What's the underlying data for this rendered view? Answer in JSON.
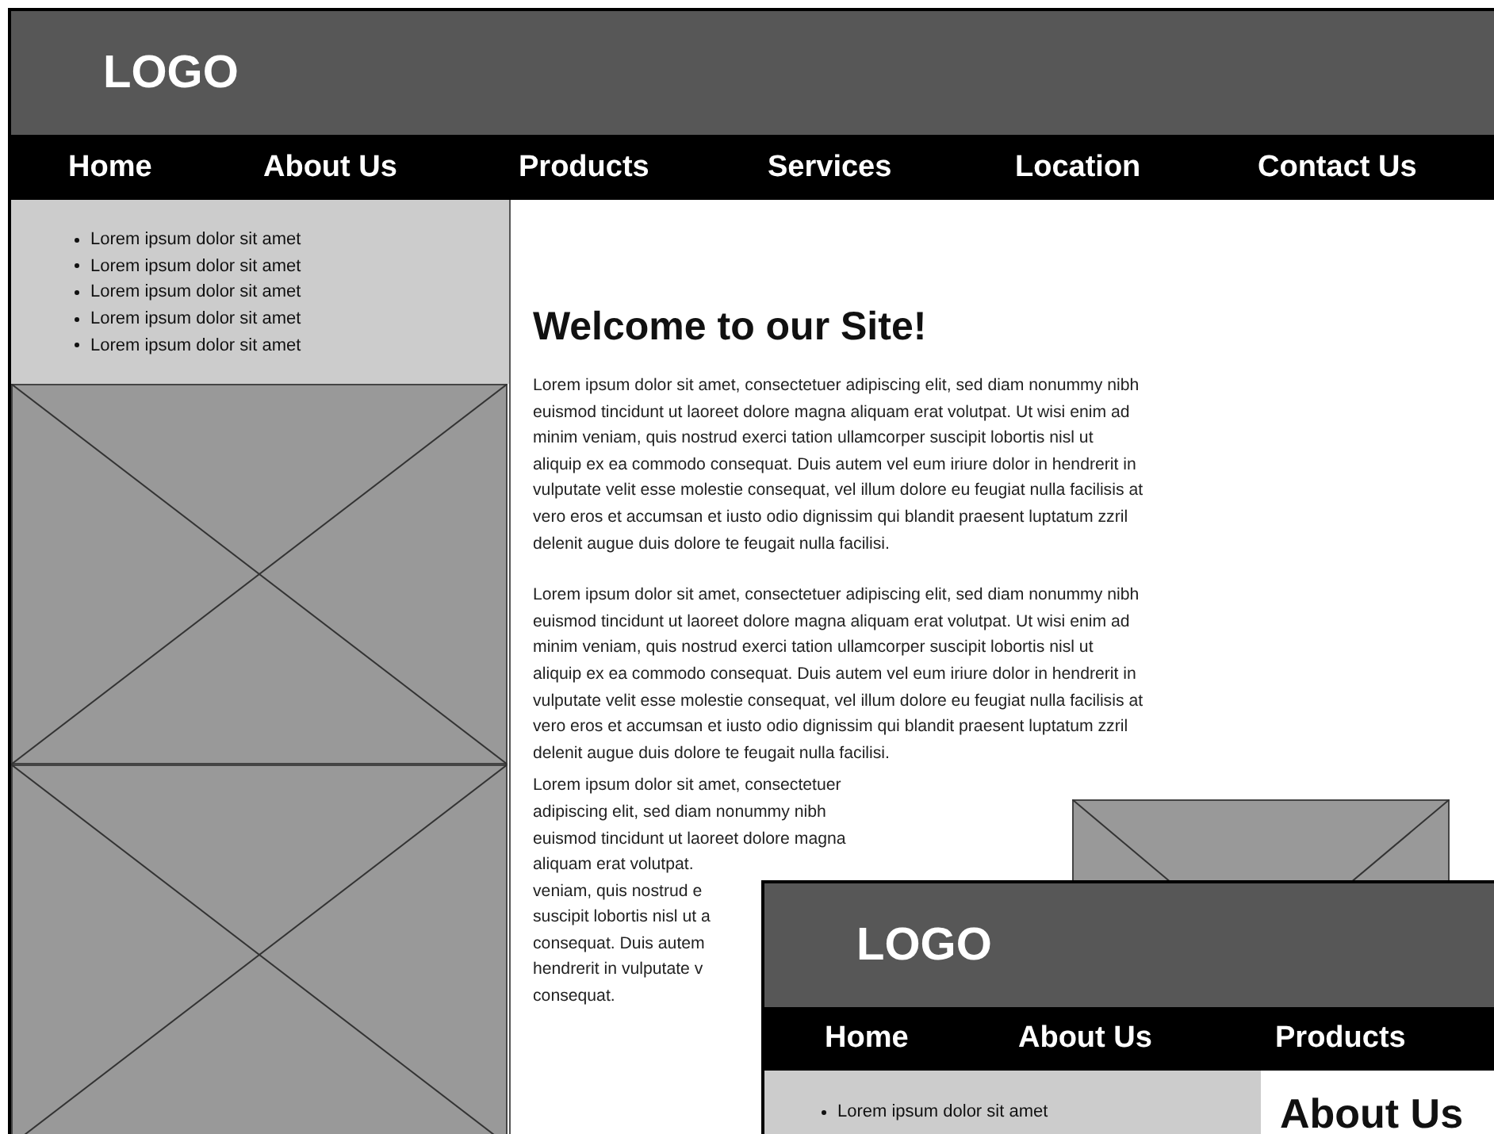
{
  "page": {
    "logo": "LOGO",
    "nav": [
      "Home",
      "About Us",
      "Products",
      "Services",
      "Location",
      "Contact Us"
    ],
    "sidebar_items": [
      "Lorem ipsum dolor sit amet",
      "Lorem ipsum dolor sit amet",
      "Lorem ipsum dolor sit amet",
      "Lorem ipsum dolor sit amet",
      "Lorem ipsum dolor sit amet"
    ],
    "heading": "Welcome to our Site!",
    "paragraphs": [
      {
        "lines": [
          "Lorem ipsum dolor sit amet, consectetuer adipiscing elit, sed diam nonummy nibh",
          "euismod tincidunt ut laoreet dolore magna aliquam erat volutpat. Ut wisi enim ad",
          "minim veniam, quis nostrud exerci tation ullamcorper suscipit lobortis nisl ut",
          "aliquip ex ea commodo consequat. Duis autem vel eum iriure dolor in hendrerit in",
          "vulputate velit esse molestie consequat, vel illum dolore eu feugiat nulla facilisis at",
          "vero eros et accumsan et iusto odio dignissim qui blandit praesent luptatum zzril",
          "delenit augue duis dolore te feugait nulla facilisi."
        ]
      },
      {
        "lines": [
          "Lorem ipsum dolor sit amet, consectetuer adipiscing elit, sed diam nonummy nibh",
          "euismod tincidunt ut laoreet dolore magna aliquam erat volutpat. Ut wisi enim ad",
          "minim veniam, quis nostrud exerci tation ullamcorper suscipit lobortis nisl ut",
          "aliquip ex ea commodo consequat. Duis autem vel eum iriure dolor in hendrerit in",
          "vulputate velit esse molestie consequat, vel illum dolore eu feugiat nulla facilisis at",
          "vero eros et accumsan et iusto odio dignissim qui blandit praesent luptatum zzril",
          "delenit augue duis dolore te feugait nulla facilisi."
        ]
      }
    ],
    "side_paragraph": {
      "lines": [
        "Lorem ipsum dolor sit amet, consectetuer",
        "adipiscing elit, sed diam nonummy nibh",
        "euismod tincidunt ut laoreet dolore magna",
        "aliquam erat volutpat.",
        "veniam, quis nostrud e",
        "suscipit lobortis nisl ut a",
        "consequat. Duis autem",
        "hendrerit in vulputate v",
        "consequat."
      ]
    }
  },
  "overlay_page": {
    "logo": "LOGO",
    "nav": [
      "Home",
      "About Us",
      "Products"
    ],
    "sidebar_items": [
      "Lorem ipsum dolor sit amet"
    ],
    "heading": "About Us"
  }
}
